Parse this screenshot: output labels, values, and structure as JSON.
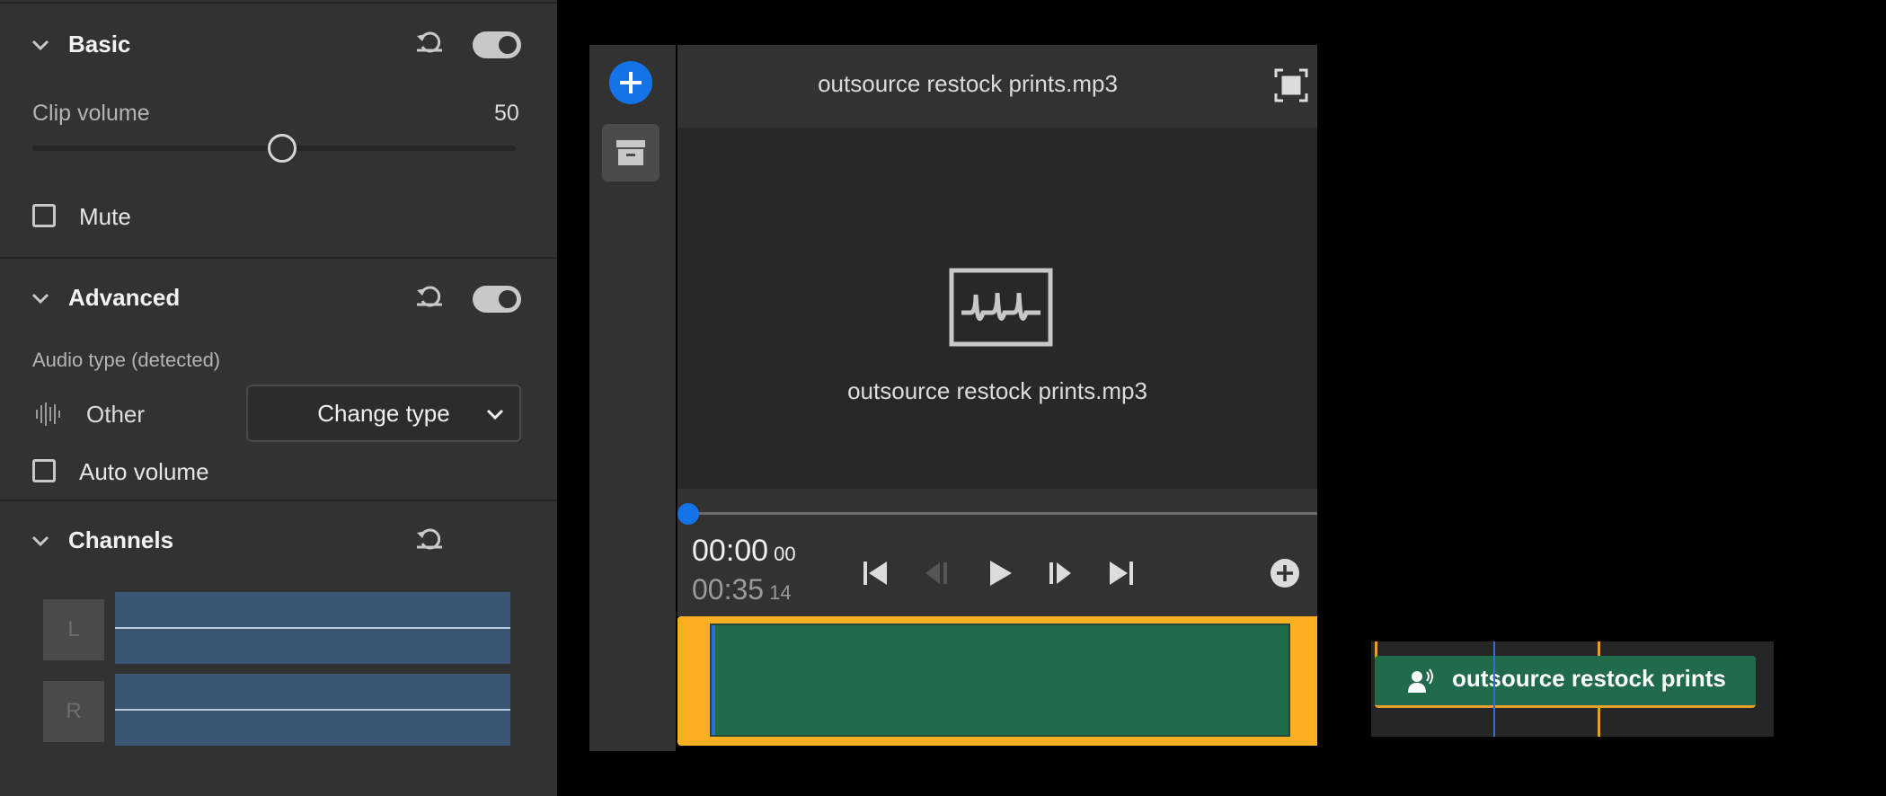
{
  "properties": {
    "basic": {
      "title": "Basic",
      "clip_volume_label": "Clip volume",
      "clip_volume_value": "50",
      "clip_volume_level": 0.5,
      "mute_label": "Mute",
      "enabled": true
    },
    "advanced": {
      "title": "Advanced",
      "audio_type_label": "Audio type (detected)",
      "audio_type_value": "Other",
      "change_type_label": "Change type",
      "auto_volume_label": "Auto volume",
      "enabled": true
    },
    "channels": {
      "title": "Channels",
      "left_label": "L",
      "right_label": "R"
    }
  },
  "preview": {
    "title": "outsource restock prints.mp3",
    "media_name": "outsource restock prints.mp3",
    "timecode_current": "00:00",
    "timecode_current_frames": "00",
    "timecode_total": "00:35",
    "timecode_total_frames": "14"
  },
  "timeline": {
    "clip_label": "outsource restock prints"
  },
  "colors": {
    "accent_blue": "#1473e6",
    "clip_green": "#1f6b4c",
    "selection_orange": "#fbb024",
    "channel_blue": "#3a5474"
  }
}
